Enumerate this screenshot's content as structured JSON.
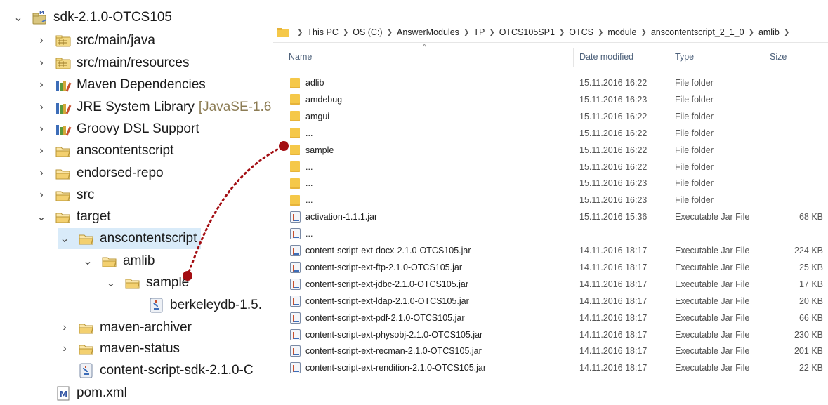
{
  "tree": {
    "items": [
      {
        "label": "sdk-2.1.0-OTCS105",
        "chevron": "⌄",
        "icon": "maven-project-icon",
        "suffix": ""
      },
      {
        "label": "src/main/java",
        "chevron": "›",
        "icon": "source-folder-icon",
        "suffix": ""
      },
      {
        "label": "src/main/resources",
        "chevron": "›",
        "icon": "source-folder-icon",
        "suffix": ""
      },
      {
        "label": "Maven Dependencies",
        "chevron": "›",
        "icon": "library-icon",
        "suffix": ""
      },
      {
        "label": "JRE System Library",
        "chevron": "›",
        "icon": "library-icon",
        "suffix": "[JavaSE-1.6"
      },
      {
        "label": "Groovy DSL Support",
        "chevron": "›",
        "icon": "library-icon",
        "suffix": ""
      },
      {
        "label": "anscontentscript",
        "chevron": "›",
        "icon": "folder-icon",
        "suffix": ""
      },
      {
        "label": "endorsed-repo",
        "chevron": "›",
        "icon": "folder-icon",
        "suffix": ""
      },
      {
        "label": "src",
        "chevron": "›",
        "icon": "folder-icon",
        "suffix": ""
      },
      {
        "label": "target",
        "chevron": "⌄",
        "icon": "folder-icon",
        "suffix": ""
      },
      {
        "label": "anscontentscript",
        "chevron": "⌄",
        "icon": "folder-icon",
        "suffix": ""
      },
      {
        "label": "amlib",
        "chevron": "⌄",
        "icon": "folder-icon",
        "suffix": ""
      },
      {
        "label": "sample",
        "chevron": "⌄",
        "icon": "folder-icon",
        "suffix": ""
      },
      {
        "label": "berkeleydb-1.5.",
        "chevron": "",
        "icon": "jar-icon",
        "suffix": ""
      },
      {
        "label": "maven-archiver",
        "chevron": "›",
        "icon": "folder-icon",
        "suffix": ""
      },
      {
        "label": "maven-status",
        "chevron": "›",
        "icon": "folder-icon",
        "suffix": ""
      },
      {
        "label": "content-script-sdk-2.1.0-C",
        "chevron": "",
        "icon": "jar-icon",
        "suffix": ""
      },
      {
        "label": "pom.xml",
        "chevron": "",
        "icon": "maven-pom-icon",
        "suffix": ""
      }
    ]
  },
  "explorer": {
    "breadcrumb": [
      "This PC",
      "OS (C:)",
      "AnswerModules",
      "TP",
      "OTCS105SP1",
      "OTCS",
      "module",
      "anscontentscript_2_1_0",
      "amlib"
    ],
    "columns": {
      "name": "Name",
      "date": "Date modified",
      "type": "Type",
      "size": "Size"
    },
    "rows": [
      {
        "name": "adlib",
        "date": "15.11.2016 16:22",
        "type": "File folder",
        "size": "",
        "icon": "folder"
      },
      {
        "name": "amdebug",
        "date": "15.11.2016 16:23",
        "type": "File folder",
        "size": "",
        "icon": "folder"
      },
      {
        "name": "amgui",
        "date": "15.11.2016 16:22",
        "type": "File folder",
        "size": "",
        "icon": "folder"
      },
      {
        "name": "...",
        "date": "15.11.2016 16:22",
        "type": "File folder",
        "size": "",
        "icon": "folder"
      },
      {
        "name": "sample",
        "date": "15.11.2016 16:22",
        "type": "File folder",
        "size": "",
        "icon": "folder"
      },
      {
        "name": "...",
        "date": "15.11.2016 16:22",
        "type": "File folder",
        "size": "",
        "icon": "folder"
      },
      {
        "name": "...",
        "date": "15.11.2016 16:23",
        "type": "File folder",
        "size": "",
        "icon": "folder"
      },
      {
        "name": "...",
        "date": "15.11.2016 16:23",
        "type": "File folder",
        "size": "",
        "icon": "folder"
      },
      {
        "name": "activation-1.1.1.jar",
        "date": "15.11.2016 15:36",
        "type": "Executable Jar File",
        "size": "68 KB",
        "icon": "jar"
      },
      {
        "name": "...",
        "date": "",
        "type": "",
        "size": "",
        "icon": "jar"
      },
      {
        "name": "content-script-ext-docx-2.1.0-OTCS105.jar",
        "date": "14.11.2016 18:17",
        "type": "Executable Jar File",
        "size": "224 KB",
        "icon": "jar"
      },
      {
        "name": "content-script-ext-ftp-2.1.0-OTCS105.jar",
        "date": "14.11.2016 18:17",
        "type": "Executable Jar File",
        "size": "25 KB",
        "icon": "jar"
      },
      {
        "name": "content-script-ext-jdbc-2.1.0-OTCS105.jar",
        "date": "14.11.2016 18:17",
        "type": "Executable Jar File",
        "size": "17 KB",
        "icon": "jar"
      },
      {
        "name": "content-script-ext-ldap-2.1.0-OTCS105.jar",
        "date": "14.11.2016 18:17",
        "type": "Executable Jar File",
        "size": "20 KB",
        "icon": "jar"
      },
      {
        "name": "content-script-ext-pdf-2.1.0-OTCS105.jar",
        "date": "14.11.2016 18:17",
        "type": "Executable Jar File",
        "size": "66 KB",
        "icon": "jar"
      },
      {
        "name": "content-script-ext-physobj-2.1.0-OTCS105.jar",
        "date": "14.11.2016 18:17",
        "type": "Executable Jar File",
        "size": "230 KB",
        "icon": "jar"
      },
      {
        "name": "content-script-ext-recman-2.1.0-OTCS105.jar",
        "date": "14.11.2016 18:17",
        "type": "Executable Jar File",
        "size": "201 KB",
        "icon": "jar"
      },
      {
        "name": "content-script-ext-rendition-2.1.0-OTCS105.jar",
        "date": "14.11.2016 18:17",
        "type": "Executable Jar File",
        "size": "22 KB",
        "icon": "jar"
      }
    ]
  },
  "annotation": {
    "color": "#a30d12"
  }
}
